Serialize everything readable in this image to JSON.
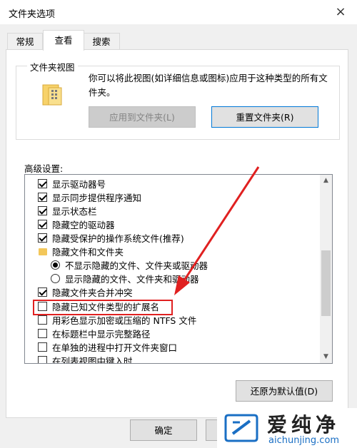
{
  "window": {
    "title": "文件夹选项",
    "close": "×"
  },
  "tabs": [
    {
      "label": "常规"
    },
    {
      "label": "查看"
    },
    {
      "label": "搜索"
    }
  ],
  "folder_views": {
    "group_title": "文件夹视图",
    "description": "你可以将此视图(如详细信息或图标)应用于这种类型的所有文件夹。",
    "apply_button": "应用到文件夹(L)",
    "reset_button": "重置文件夹(R)"
  },
  "advanced": {
    "label": "高级设置:",
    "items": [
      {
        "type": "checkbox",
        "checked": true,
        "label": "显示驱动器号"
      },
      {
        "type": "checkbox",
        "checked": true,
        "label": "显示同步提供程序通知"
      },
      {
        "type": "checkbox",
        "checked": true,
        "label": "显示状态栏"
      },
      {
        "type": "checkbox",
        "checked": true,
        "label": "隐藏空的驱动器"
      },
      {
        "type": "checkbox",
        "checked": true,
        "label": "隐藏受保护的操作系统文件(推荐)"
      },
      {
        "type": "folder",
        "label": "隐藏文件和文件夹"
      },
      {
        "type": "radio",
        "checked": true,
        "label": "不显示隐藏的文件、文件夹或驱动器"
      },
      {
        "type": "radio",
        "checked": false,
        "label": "显示隐藏的文件、文件夹和驱动器"
      },
      {
        "type": "checkbox",
        "checked": true,
        "label": "隐藏文件夹合并冲突"
      },
      {
        "type": "checkbox",
        "checked": false,
        "label": "隐藏已知文件类型的扩展名"
      },
      {
        "type": "checkbox",
        "checked": false,
        "label": "用彩色显示加密或压缩的 NTFS 文件"
      },
      {
        "type": "checkbox",
        "checked": false,
        "label": "在标题栏中显示完整路径"
      },
      {
        "type": "checkbox",
        "checked": false,
        "label": "在单独的进程中打开文件夹窗口"
      },
      {
        "type": "checkbox",
        "checked": false,
        "label": "在列表视图中键入时"
      }
    ],
    "restore_button": "还原为默认值(D)"
  },
  "footer": {
    "ok_button": "确定"
  },
  "watermark": {
    "brand": "爱纯净",
    "url": "aichunjing.com"
  },
  "colors": {
    "highlight": "#e02020",
    "accent": "#0078d7"
  }
}
